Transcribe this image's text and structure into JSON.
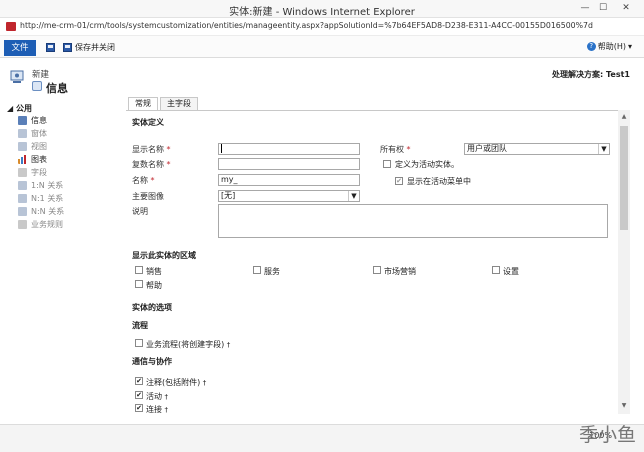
{
  "window": {
    "title": "实体:新建 - Windows Internet Explorer",
    "controls": [
      "—",
      "☐",
      "✕"
    ]
  },
  "address": {
    "url": "http://me-crm-01/crm/tools/systemcustomization/entities/manageentity.aspx?appSolutionId=%7b64EF5AD8-D238-E311-A4CC-00155D016500%7d"
  },
  "ribbon": {
    "file_label": "文件",
    "save_close_label": "保存并关闭",
    "help_label": "帮助(H)"
  },
  "header": {
    "new_label": "新建",
    "title": "信息",
    "solution_label": "处理解决方案: Test1"
  },
  "sidebar": {
    "section_label": "公用",
    "items": [
      {
        "label": "信息",
        "icon": "info-icon",
        "active": true
      },
      {
        "label": "窗体",
        "icon": "form-icon",
        "active": false
      },
      {
        "label": "视图",
        "icon": "view-icon",
        "active": false
      },
      {
        "label": "图表",
        "icon": "chart-icon",
        "active": true
      },
      {
        "label": "字段",
        "icon": "field-icon",
        "active": false
      },
      {
        "label": "1:N 关系",
        "icon": "relationship-icon",
        "active": false
      },
      {
        "label": "N:1 关系",
        "icon": "relationship-icon",
        "active": false
      },
      {
        "label": "N:N 关系",
        "icon": "relationship-icon",
        "active": false
      },
      {
        "label": "业务规则",
        "icon": "rule-icon",
        "active": false
      }
    ]
  },
  "tabs": [
    "常规",
    "主字段"
  ],
  "form": {
    "entity_definition": "实体定义",
    "display_name_label": "显示名称",
    "plural_name_label": "复数名称",
    "name_label": "名称",
    "name_value": "my_",
    "primary_image_label": "主要图像",
    "primary_image_value": "[无]",
    "description_label": "说明",
    "ownership_label": "所有权",
    "ownership_value": "用户或团队",
    "define_as_activity_label": "定义为活动实体。",
    "show_in_activity_menu_label": "显示在活动菜单中",
    "areas_title": "显示此实体的区域",
    "areas": [
      "销售",
      "服务",
      "市场营销",
      "设置",
      "帮助"
    ],
    "options_title": "实体的选项",
    "process_title": "流程",
    "business_process_label": "业务流程(将创建字段)",
    "communication_title": "通信与协作",
    "communication_items": [
      "注释(包括附件)",
      "活动",
      "连接"
    ]
  },
  "status": {
    "zoom": "100%",
    "watermark": "季小鱼"
  },
  "colors": {
    "file_tab": "#1e5eb5",
    "required": "#c0262d"
  }
}
